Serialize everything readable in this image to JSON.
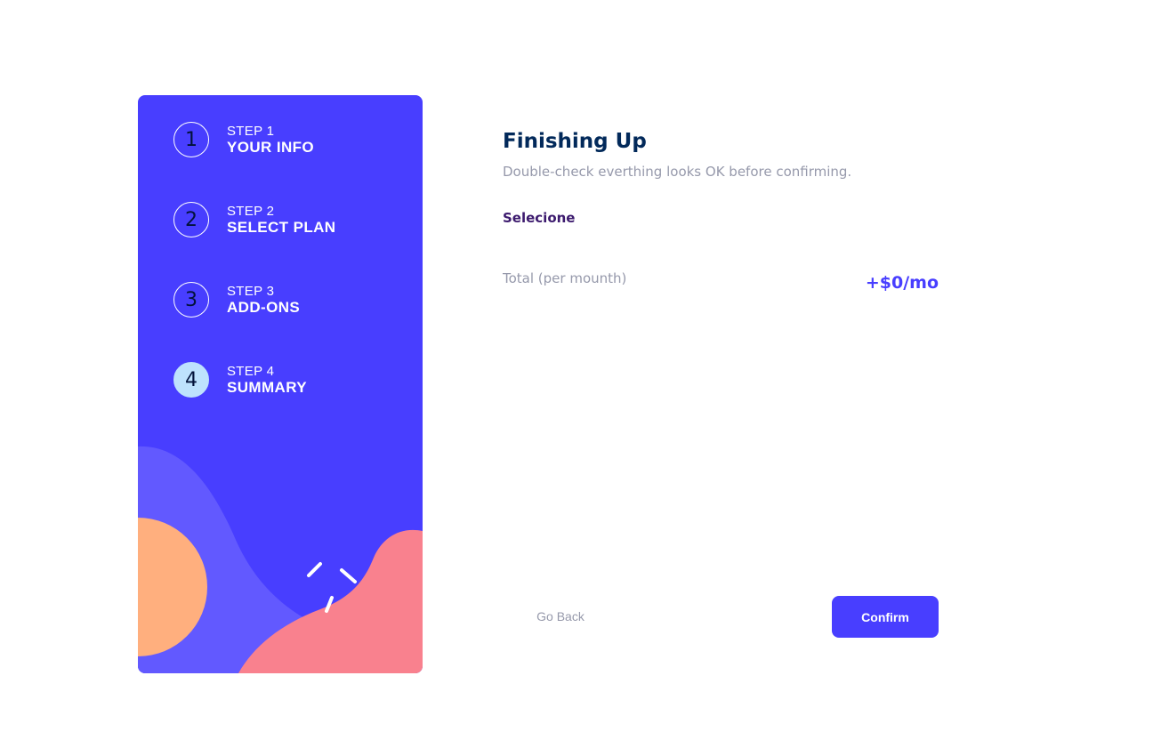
{
  "sidebar": {
    "steps": [
      {
        "number": "1",
        "caption": "STEP 1",
        "title": "YOUR INFO",
        "active": false
      },
      {
        "number": "2",
        "caption": "STEP 2",
        "title": "SELECT PLAN",
        "active": false
      },
      {
        "number": "3",
        "caption": "STEP 3",
        "title": "ADD-ONS",
        "active": false
      },
      {
        "number": "4",
        "caption": "STEP 4",
        "title": "SUMMARY",
        "active": true
      }
    ]
  },
  "main": {
    "title": "Finishing Up",
    "subtitle": "Double-check everthing looks OK before confirming.",
    "plan_name": "Selecione",
    "total_label": "Total (per mounth)",
    "total_value": "+$0/mo"
  },
  "buttons": {
    "back_label": "Go Back",
    "confirm_label": "Confirm"
  },
  "colors": {
    "sidebar_bg": "#483eff",
    "active_step": "#bee2fd",
    "accent": "#483eff",
    "heading": "#02295a",
    "muted": "#9699ab",
    "blob_light": "#6259ff",
    "blob_orange": "#ffaf7e",
    "blob_pink": "#f9818e"
  }
}
